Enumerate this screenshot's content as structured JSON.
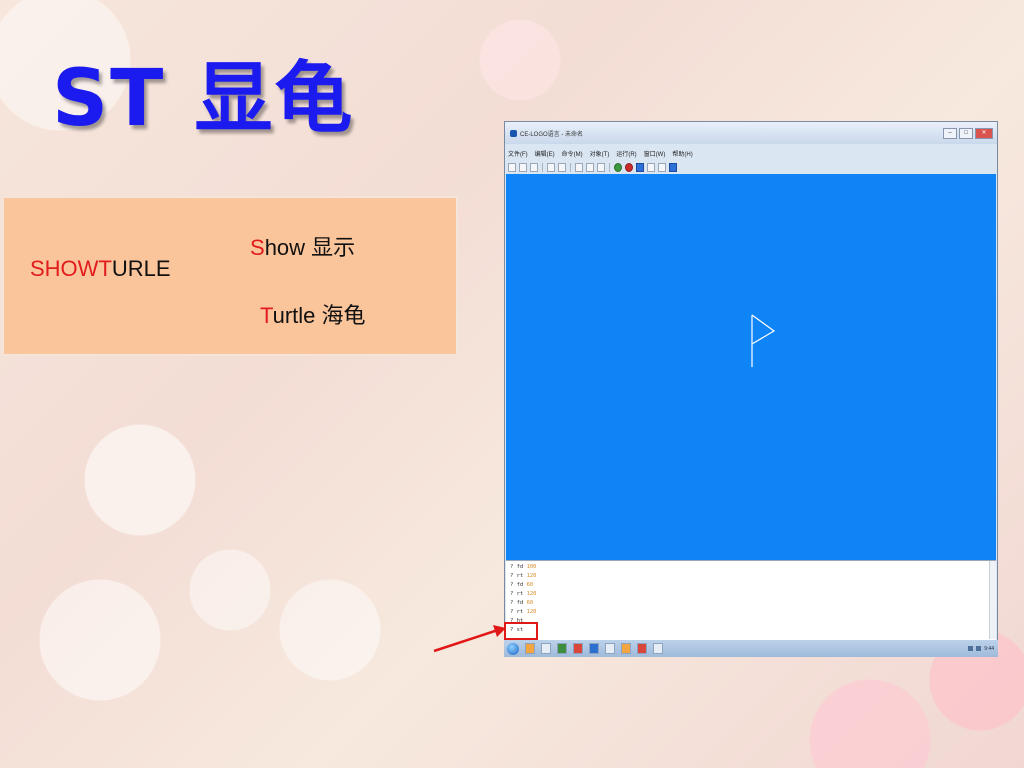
{
  "slide": {
    "title": "ST 显龟"
  },
  "explanation": {
    "show": {
      "initial": "S",
      "rest": "how  显示"
    },
    "command": {
      "p1": "SHOW",
      "p2": "T",
      "p3": "URLE"
    },
    "turtle": {
      "initial": "T",
      "rest": "urtle  海龟"
    }
  },
  "window": {
    "title": "CE-LOGO语言 - 未命名",
    "controls": {
      "min": "–",
      "max": "□",
      "close": "✕"
    },
    "menu": [
      "文件(F)",
      "编辑(E)",
      "命令(M)",
      "对象(T)",
      "运行(R)",
      "窗口(W)",
      "帮助(H)"
    ],
    "toolbar_icons": [
      "new-icon",
      "open-icon",
      "save-icon",
      "undo-icon",
      "redo-icon",
      "cut-icon",
      "copy-icon",
      "paste-icon",
      "run-icon",
      "stop-icon",
      "pen-icon",
      "color-icon",
      "grid-icon",
      "help-icon"
    ]
  },
  "commands": [
    {
      "cmd": "fd",
      "arg": "100"
    },
    {
      "cmd": "rt",
      "arg": "120"
    },
    {
      "cmd": "fd",
      "arg": "60"
    },
    {
      "cmd": "rt",
      "arg": "120"
    },
    {
      "cmd": "fd",
      "arg": "60"
    },
    {
      "cmd": "rt",
      "arg": "120"
    },
    {
      "cmd": "ht",
      "arg": ""
    },
    {
      "cmd": "st",
      "arg": ""
    }
  ],
  "prompt_symbol": "?",
  "taskbar": {
    "clock": "9:44"
  },
  "colors": {
    "title": "#1b1bf0",
    "canvas": "#0f84f6",
    "explain_bg": "#fbc59b",
    "accent_red": "#e21c1c"
  }
}
